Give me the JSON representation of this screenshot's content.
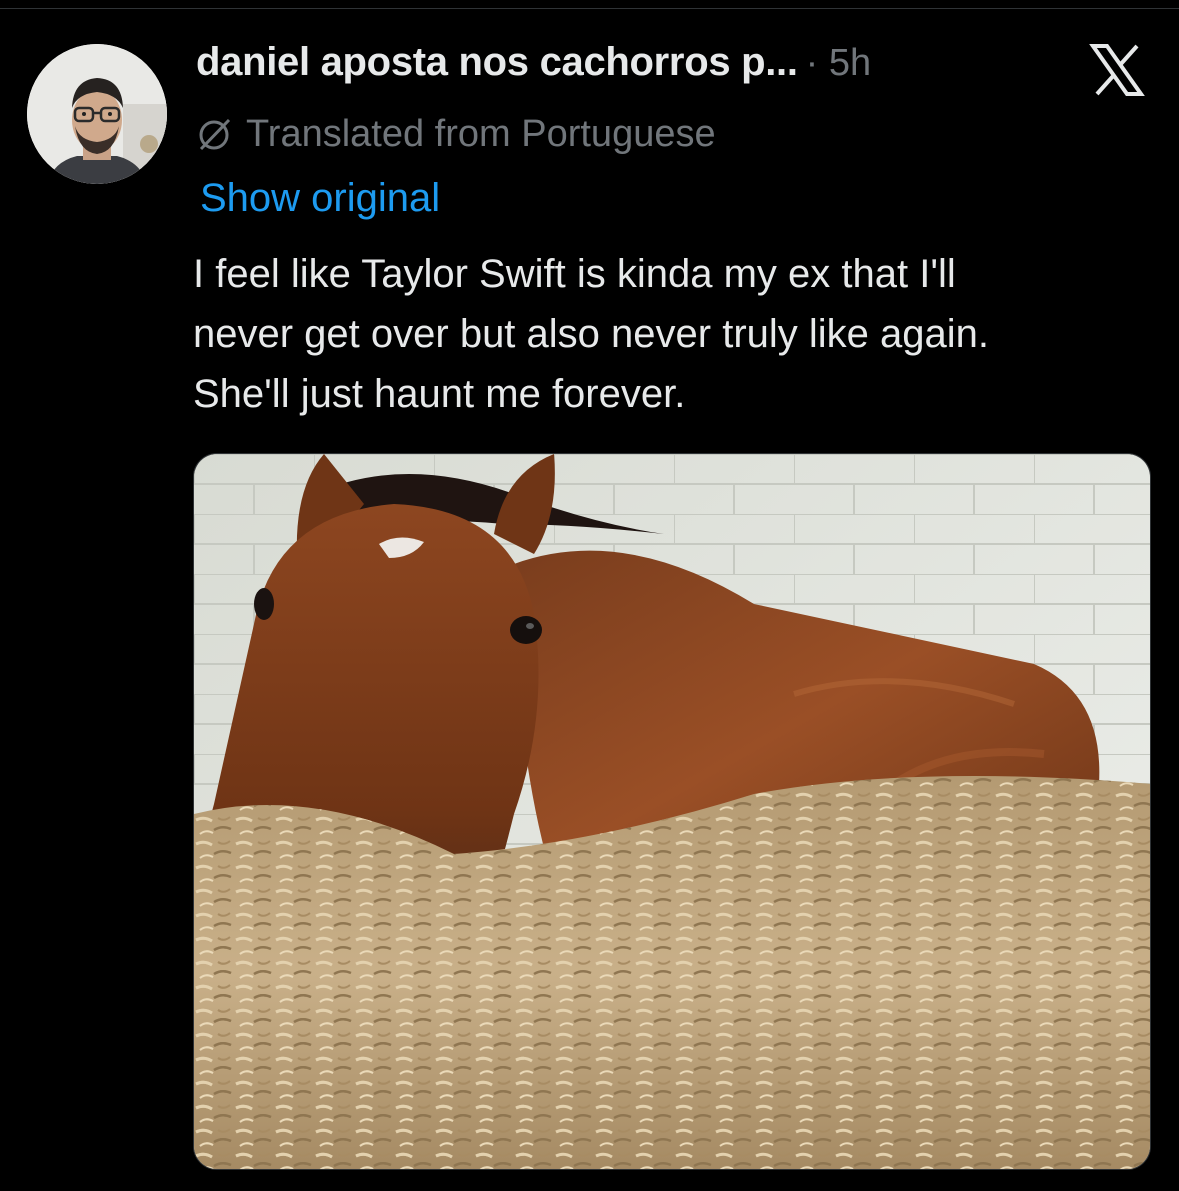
{
  "tweet": {
    "author_name": "daniel aposta nos cachorros p...",
    "separator_time": "· 5h",
    "translation_label": "Translated from Portuguese",
    "show_original_label": "Show original",
    "text_lines": [
      "I feel like Taylor Swift is kinda my ex that I'll",
      "never get over but also never truly like again.",
      "She'll just haunt me forever."
    ]
  },
  "icons": {
    "avatar": "avatar",
    "translate": "translate-icon",
    "brand": "x-logo-icon"
  },
  "colors": {
    "background": "#000000",
    "text": "#e7e9ea",
    "muted": "#71767b",
    "link": "#1d9bf0"
  }
}
